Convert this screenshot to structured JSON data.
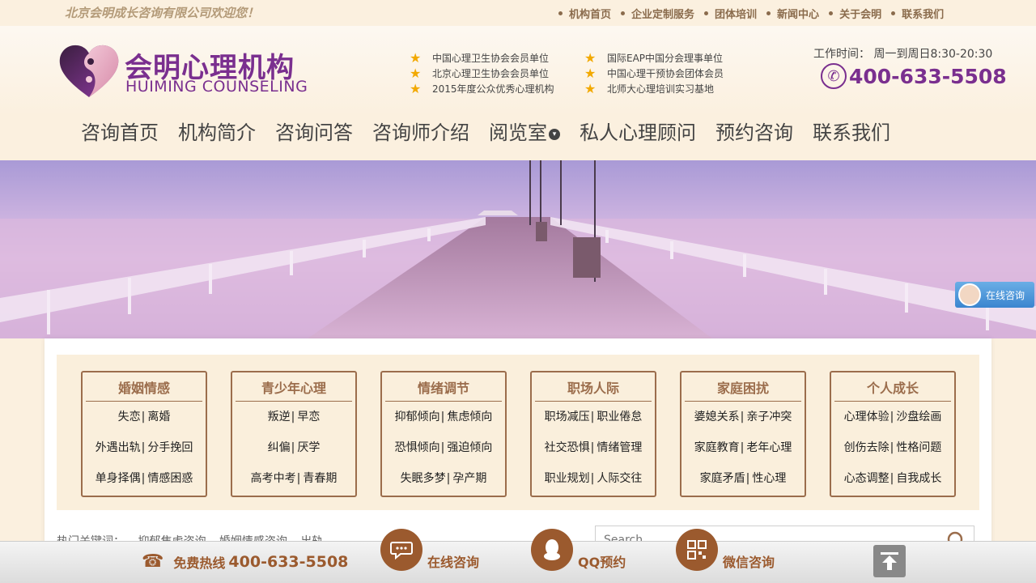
{
  "topbar": {
    "welcome": "北京会明成长咨询有限公司欢迎您！",
    "links": [
      "机构首页",
      "企业定制服务",
      "团体培训",
      "新闻中心",
      "关于会明",
      "联系我们"
    ]
  },
  "header": {
    "logo_cn": "会明心理机构",
    "logo_en": "HUIMING COUNSELING",
    "credentials_left": [
      "中国心理卫生协会会员单位",
      "北京心理卫生协会会员单位",
      "2015年度公众优秀心理机构"
    ],
    "credentials_right": [
      "国际EAP中国分会理事单位",
      "中国心理干预协会团体会员",
      "北师大心理培训实习基地"
    ],
    "work_time": "工作时间： 周一到周日8:30-20:30",
    "hotline": "400-633-5508"
  },
  "nav": {
    "items": [
      "咨询首页",
      "机构简介",
      "咨询问答",
      "咨询师介绍",
      "阅览室",
      "私人心理顾问",
      "预约咨询",
      "联系我们"
    ]
  },
  "categories": [
    {
      "title": "婚姻情感",
      "rows": [
        [
          "失恋",
          "离婚"
        ],
        [
          "外遇出轨",
          "分手挽回"
        ],
        [
          "单身择偶",
          "情感困惑"
        ]
      ]
    },
    {
      "title": "青少年心理",
      "rows": [
        [
          "叛逆",
          "早恋"
        ],
        [
          "纠偏",
          "厌学"
        ],
        [
          "高考中考",
          "青春期"
        ]
      ]
    },
    {
      "title": "情绪调节",
      "rows": [
        [
          "抑郁倾向",
          "焦虑倾向"
        ],
        [
          "恐惧倾向",
          "强迫倾向"
        ],
        [
          "失眠多梦",
          "孕产期"
        ]
      ]
    },
    {
      "title": "职场人际",
      "rows": [
        [
          "职场减压",
          "职业倦怠"
        ],
        [
          "社交恐惧",
          "情绪管理"
        ],
        [
          "职业规划",
          "人际交往"
        ]
      ]
    },
    {
      "title": "家庭困扰",
      "rows": [
        [
          "婆媳关系",
          "亲子冲突"
        ],
        [
          "家庭教育",
          "老年心理"
        ],
        [
          "家庭矛盾",
          "性心理"
        ]
      ]
    },
    {
      "title": "个人成长",
      "rows": [
        [
          "心理体验",
          "沙盘绘画"
        ],
        [
          "创伤去除",
          "性格问题"
        ],
        [
          "心态调整",
          "自我成长"
        ]
      ]
    }
  ],
  "hot": {
    "label": "热门关键词：",
    "keywords": [
      "抑郁焦虑咨询",
      "婚姻情感咨询",
      "出轨"
    ]
  },
  "search": {
    "placeholder": "Search"
  },
  "float_chat": {
    "label": "在线咨询"
  },
  "bottombar": {
    "hotline_label": "免费热线",
    "hotline_number": "400-633-5508",
    "online_label": "在线咨询",
    "qq_label": "QQ预约",
    "wechat_label": "微信咨询"
  },
  "colors": {
    "brand_purple": "#7a2f8f",
    "accent_brown": "#9b6d4c",
    "background": "#fbf0df"
  }
}
